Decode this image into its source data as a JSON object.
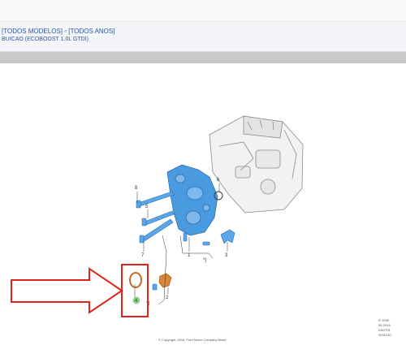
{
  "header": {
    "breadcrumb": "[TODOS MODELOS] ▫ [TODOS ANOS]",
    "subtitle": "BUICAO (ECOBOOST 1.0L GTDI)"
  },
  "callouts": [
    "8",
    "6",
    "5",
    "7",
    "1",
    "3",
    "4",
    "2"
  ],
  "highlighted_part": "4",
  "side_marks": [
    "*)",
    "*)"
  ],
  "meta_lines": [
    "R 1095",
    "05-2016",
    "E8GT01",
    "3031010"
  ],
  "copyright": "© Copyright, 2016, Ford Motor Company Brasil",
  "colors": {
    "link": "#2d55a3",
    "part_blue": "#4a9ae0",
    "highlight_red": "#e0241b",
    "gasket_orange": "#d8873a",
    "highlight_dot": "#8ed58a"
  }
}
